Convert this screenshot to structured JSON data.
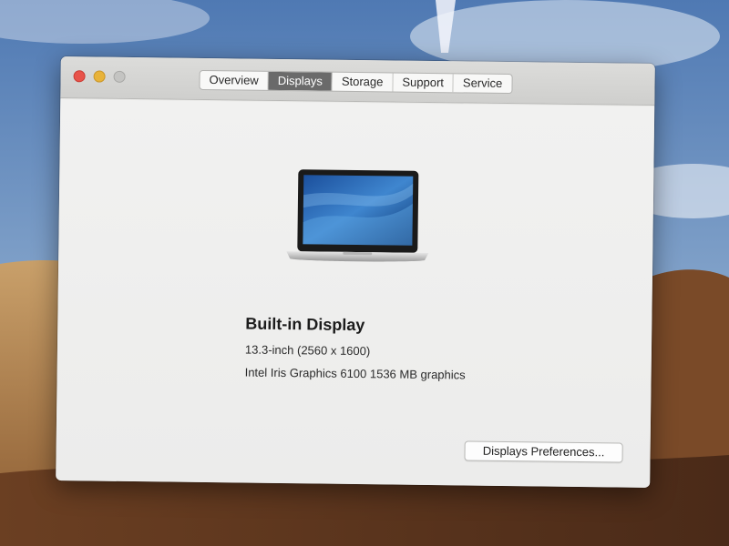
{
  "window": {
    "tabs": [
      {
        "label": "Overview",
        "active": false
      },
      {
        "label": "Displays",
        "active": true
      },
      {
        "label": "Storage",
        "active": false
      },
      {
        "label": "Support",
        "active": false
      },
      {
        "label": "Service",
        "active": false
      }
    ]
  },
  "display": {
    "name": "Built-in Display",
    "size": "13.3-inch (2560 x 1600)",
    "graphics": "Intel Iris Graphics 6100 1536 MB graphics",
    "icon": "laptop-icon"
  },
  "actions": {
    "preferences_label": "Displays Preferences..."
  },
  "colors": {
    "close": "#e8534a",
    "minimize": "#e8b33a",
    "zoom_disabled": "#c4c4c2",
    "active_tab": "#6a6a6a"
  }
}
